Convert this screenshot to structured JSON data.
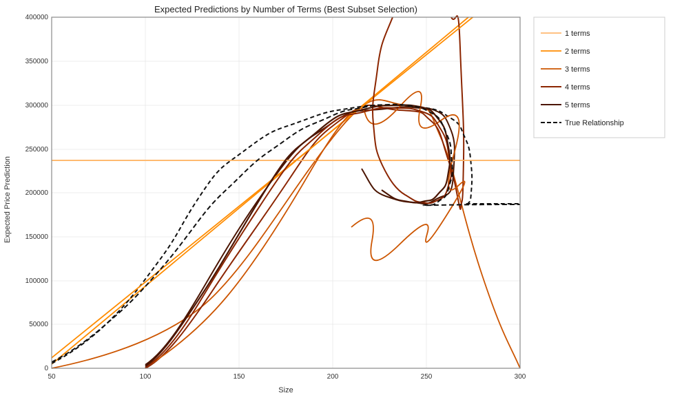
{
  "title": "Expected Predictions by Number of Terms (Best Subset Selection)",
  "xLabel": "Size",
  "yLabel": "Expected Price Prediction",
  "legend": [
    {
      "label": "1 terms",
      "color": "#FFB347",
      "dash": "none"
    },
    {
      "label": "2 terms",
      "color": "#FF8C00",
      "dash": "none"
    },
    {
      "label": "3 terms",
      "color": "#CC5500",
      "dash": "none"
    },
    {
      "label": "4 terms",
      "color": "#8B2500",
      "dash": "none"
    },
    {
      "label": "5 terms",
      "color": "#4B1500",
      "dash": "none"
    },
    {
      "label": "True Relationship",
      "color": "#000000",
      "dash": "dashed"
    }
  ],
  "yAxis": {
    "min": 0,
    "max": 400000,
    "ticks": [
      0,
      50000,
      100000,
      150000,
      200000,
      250000,
      300000,
      350000,
      400000
    ]
  },
  "xAxis": {
    "min": 50,
    "max": 300,
    "ticks": [
      50,
      100,
      150,
      200,
      250,
      300
    ]
  }
}
